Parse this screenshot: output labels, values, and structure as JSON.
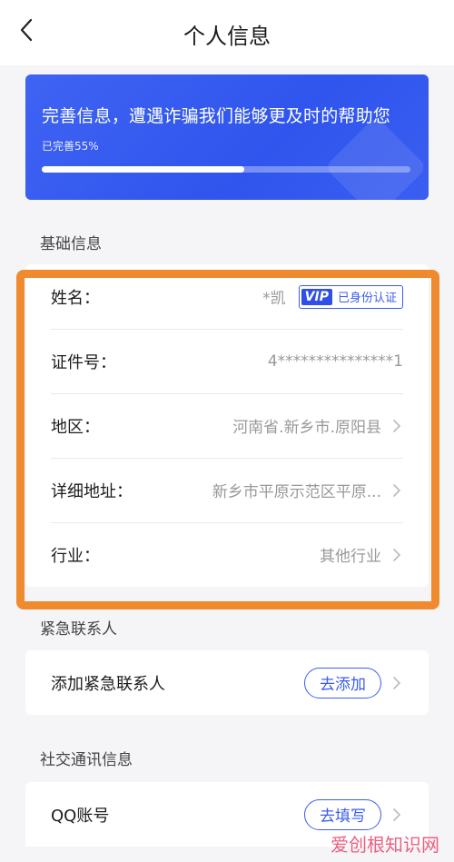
{
  "header": {
    "title": "个人信息"
  },
  "banner": {
    "text": "完善信息，遭遇诈骗我们能够更及时的帮助您",
    "progress_label": "已完善55%",
    "progress": 0.55
  },
  "basic_section": {
    "title": "基础信息",
    "rows": [
      {
        "label": "姓名：",
        "value": "*凯",
        "badge_logo": "VIP",
        "badge_text": "已身份认证"
      },
      {
        "label": "证件号：",
        "value": "4***************1"
      },
      {
        "label": "地区：",
        "value": "河南省.新乡市.原阳县"
      },
      {
        "label": "详细地址：",
        "value": "新乡市平原示范区平原..."
      },
      {
        "label": "行业：",
        "value": "其他行业"
      }
    ]
  },
  "emergency_section": {
    "title": "紧急联系人",
    "row": {
      "label": "添加紧急联系人",
      "button": "去添加"
    }
  },
  "social_section": {
    "title": "社交通讯信息",
    "row": {
      "label": "QQ账号",
      "button": "去填写"
    }
  },
  "watermark": "爱创根知识网",
  "colors": {
    "accent": "#3b5cf0",
    "highlight": "#f08a2e",
    "banner": "#3f63f2"
  }
}
